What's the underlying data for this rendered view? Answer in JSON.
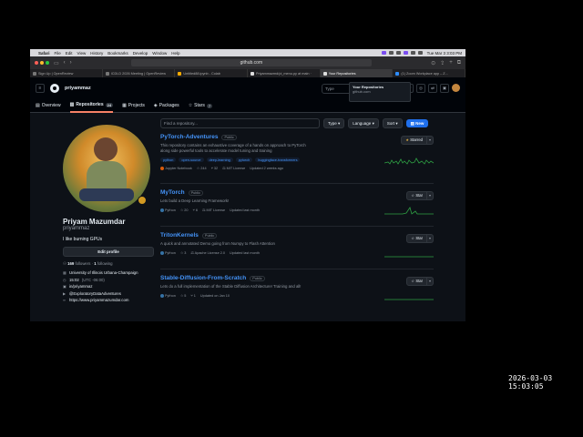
{
  "menubar": {
    "app": "Safari",
    "items": [
      "File",
      "Edit",
      "View",
      "History",
      "Bookmarks",
      "Develop",
      "Window",
      "Help"
    ],
    "clock": "Tue Mar 3  3:03 PM"
  },
  "browser": {
    "url": "github.com",
    "tabs": [
      {
        "label": "Sign Up | OpenReview",
        "active": false
      },
      {
        "label": "ICDLD 2026 Meeting | OpenReview",
        "active": false
      },
      {
        "label": "Untitled88.ipynb - Colab",
        "active": false
      },
      {
        "label": "Priyammazmd/pi_menu.py at main ·",
        "active": false
      },
      {
        "label": "Your Repositories",
        "active": true
      },
      {
        "label": "(1) Zoom Workplace app – Z...",
        "active": false
      }
    ]
  },
  "header": {
    "username": "priyammaz",
    "search_placeholder": "Type",
    "tooltip_title": "Your Repositories",
    "tooltip_sub": "github.com"
  },
  "profile_nav": {
    "overview": "Overview",
    "repositories": "Repositories",
    "repo_count": "24",
    "projects": "Projects",
    "packages": "Packages",
    "stars": "Stars",
    "star_count": "7"
  },
  "profile": {
    "name": "Priyam Mazumdar",
    "login": "priyammaz",
    "bio": "I like burning GPUs",
    "edit_label": "Edit profile",
    "followers": "169",
    "followers_label": "followers",
    "following": "1",
    "following_label": "following",
    "org": "University of Illinois Urbana-Champaign",
    "time": "15:02",
    "tz": "(UTC -06:00)",
    "linkedin": "in/priyammaz",
    "social": "@ExploratoryDataAdventures",
    "website": "https://www.priyammazumdar.com"
  },
  "filters": {
    "find_placeholder": "Find a repository...",
    "type": "Type",
    "language": "Language",
    "sort": "Sort",
    "new": "New"
  },
  "repos": [
    {
      "name": "PyTorch-Adventures",
      "visibility": "Public",
      "description": "This repository contains an exhaustive coverage of a hands on approach to PyTorch along side powerful tools to accelerate model tuning and training",
      "topics": [
        "python",
        "open-source",
        "deep-learning",
        "pytorch",
        "huggingface-transformers"
      ],
      "language": "Jupyter Notebook",
      "lang_color": "#da5b0b",
      "stars": "244",
      "forks": "32",
      "license": "MIT License",
      "updated": "Updated 2 weeks ago",
      "star_label": "Starred"
    },
    {
      "name": "MyTorch",
      "visibility": "Public",
      "description": "Lets build a Deep Learning Framework!",
      "topics": [],
      "language": "Python",
      "lang_color": "#3572a5",
      "stars": "20",
      "forks": "6",
      "license": "MIT License",
      "updated": "Updated last month",
      "star_label": "Star"
    },
    {
      "name": "TritonKernels",
      "visibility": "Public",
      "description": "A quick and annotated Demo going from Numpy to Flash Attention",
      "topics": [],
      "language": "Python",
      "lang_color": "#3572a5",
      "stars": "3",
      "forks": "",
      "license": "Apache License 2.0",
      "updated": "Updated last month",
      "star_label": "Star"
    },
    {
      "name": "Stable-Diffusion-From-Scratch",
      "visibility": "Public",
      "description": "Lets do a full implementation of the Stable Diffusion Architecture! Training and all!",
      "topics": [],
      "language": "Python",
      "lang_color": "#3572a5",
      "stars": "5",
      "forks": "1",
      "license": "",
      "updated": "Updated on Jan 10",
      "star_label": "Star"
    }
  ],
  "overlay_timestamp": "2026-03-03  15:03:05",
  "colors": {
    "accent": "#1f6feb",
    "link": "#4493f8",
    "bg": "#0d1117",
    "spark": "#2ea043"
  }
}
